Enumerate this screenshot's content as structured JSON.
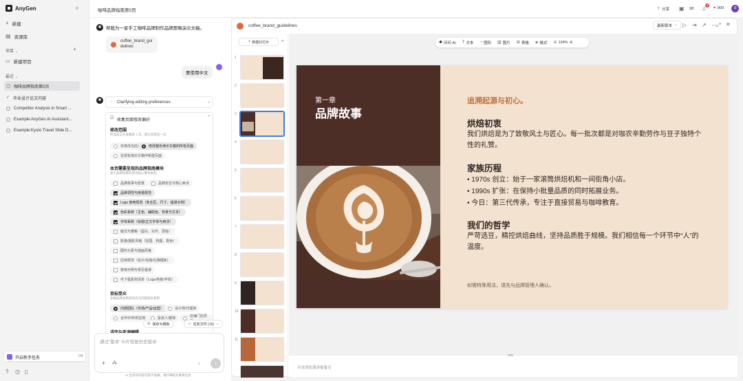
{
  "app": {
    "brand": "AnyGen",
    "doc_title": "咖啡品牌指南第5页"
  },
  "sidebar": {
    "new": "新建",
    "assets": "资源库",
    "projects_label": "项目",
    "new_project": "新建项目",
    "recent_label": "最近",
    "recent": [
      "咖啡品牌指南第5页",
      "毕业设计论文内容",
      "Competitor Analysis in Smart ...",
      "Example:AnyGen AI Assistant...",
      "Example:Kyoto Travel Slide D..."
    ],
    "newbie_task": "开启新手任务",
    "newbie_progress": "0%"
  },
  "topbar": {
    "share": "分享",
    "notif_count": "3",
    "credits": "800",
    "user_initial": "d"
  },
  "chat": {
    "assistant_msg": "帮我为一家手工咖啡品牌制作品牌策略演示文稿。",
    "file_name": "coffee_brand_guidelines",
    "user_msg": "要使用中文",
    "step_label": "Clarifying editing preferences",
    "pref_title": "收集页面修改偏好",
    "q1": {
      "title": "修改范围",
      "sub": "你当前正在查看第 1 页，默认先改这一页",
      "options": [
        "仅修改当前页",
        "修改整份演示文稿的所有页面",
        "在现有演示文稿中新建页面"
      ],
      "selected": 1
    },
    "q2": {
      "title": "本页需要呈现的品牌指南模块",
      "sub": "基于品牌指南的常见核心模块挑选",
      "options": [
        {
          "label": "品牌故事与愿景",
          "checked": false
        },
        {
          "label": "品牌定位与核心卖点",
          "checked": false
        },
        {
          "label": "品牌调性与用语规范",
          "checked": true
        },
        {
          "label": "Logo 使用规范（安全区、尺寸、错误示例）",
          "checked": true
        },
        {
          "label": "色彩系统（主色、辅助色、背景与文本）",
          "checked": true
        },
        {
          "label": "字体系统（标题/正文字体与用法）",
          "checked": true
        },
        {
          "label": "版式与栅格（留白、对齐、层级）",
          "checked": false
        },
        {
          "label": "影像/摄影风格（氛围、构图、配色）",
          "checked": false
        },
        {
          "label": "图形元素与插画风格",
          "checked": false
        },
        {
          "label": "应用规范（名片/包装/社媒模板）",
          "checked": false
        },
        {
          "label": "禁用示例与常见错误",
          "checked": false
        },
        {
          "label": "可下载素材清单（Logo/色板/字体）",
          "checked": false
        }
      ]
    },
    "q3": {
      "title": "目标受众",
      "sub": "多数品牌指南首先作为内部团队使用",
      "options": [
        "内部团队（市场/产品/运营）",
        "设计师/代理商",
        "合作伙伴/供应商",
        "投资人/媒体",
        "店铺门店员工"
      ],
      "selected": 0
    },
    "q4_title": "讲完与老调编辑",
    "save_template": "保存为模板",
    "task_files": "任务文件 (16)",
    "input_placeholder": "通过\"版本\"卡片恢复历史版本",
    "disclaimer": "AI 生成的内容可能不准确。请仔细核对重要信息"
  },
  "editor": {
    "file_name": "coffee_brand_guidelines",
    "version": "最新版本",
    "new_slide": "新建幻灯片",
    "slide_numbers": [
      "1",
      "2",
      "3",
      "4",
      "5",
      "6",
      "7",
      "8",
      "9",
      "10",
      "11"
    ],
    "selected_slide": 3,
    "toolbar": {
      "ask_ai": "问问 AI",
      "text": "文本",
      "shape": "图形",
      "image": "图片",
      "table": "表格",
      "format": "格式",
      "zoom": "134%"
    },
    "notes_placeholder": "点击添加演讲者备注"
  },
  "slide": {
    "chapter": "第一章",
    "title": "品牌故事",
    "tagline": "追溯起源与初心。",
    "sec1_title": "烘焙初衷",
    "sec1_body": "我们烘焙是为了致敬风土与匠心。每一批次都是对咖农辛勤劳作与豆子独特个性的礼赞。",
    "sec2_title": "家族历程",
    "sec2_items": [
      "1970s 创立：始于一家滚筒烘焙机和一间街角小店。",
      "1990s 扩张：在保持小批量品质的同时拓展业务。",
      "今日：第三代传承，专注于直接贸易与咖啡教育。"
    ],
    "sec3_title": "我们的哲学",
    "sec3_body": "严苛选豆，精控烘焙曲线，坚持品质胜于规模。我们相信每一个环节中“人”的温度。",
    "footer": "如需特殊用法，请先与品牌管理人确认。"
  },
  "colors": {
    "slide_dark": "#4d2e26",
    "slide_bg": "#f3e2cf",
    "accent": "#c0733c",
    "select_blue": "#3a7ae4"
  }
}
